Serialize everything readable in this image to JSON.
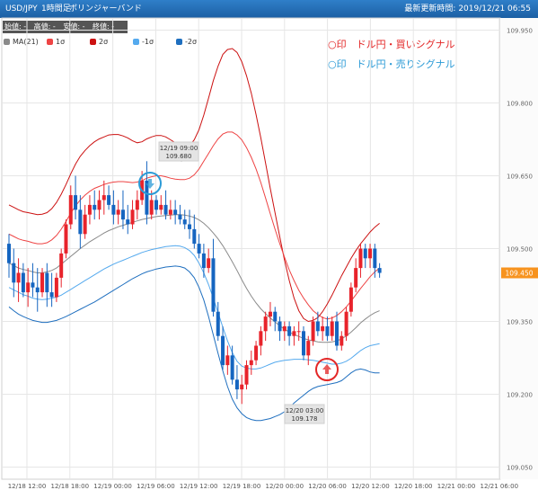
{
  "header": {
    "symbol": "USD/JPY",
    "timeframe": "1時間足",
    "indicator": "ボリンジャーバンド",
    "updated": "最新更新時間: 2019/12/21 06:55"
  },
  "ohlc_bar": {
    "open": "始値: -",
    "high": "高値: -",
    "low": "安値: -",
    "close": "終値: -"
  },
  "legend": [
    {
      "label": "MA(21)",
      "color": "#8a8a8a"
    },
    {
      "label": "1σ",
      "color": "#ee4444"
    },
    {
      "label": "2σ",
      "color": "#cc1111"
    },
    {
      "label": "-1σ",
      "color": "#55aaee"
    },
    {
      "label": "-2σ",
      "color": "#1f6fbf"
    }
  ],
  "notes": [
    {
      "text": "○印　ドル円・買いシグナル",
      "color": "#e32626"
    },
    {
      "text": "○印　ドル円・売りシグナル",
      "color": "#2a9ad6"
    }
  ],
  "colors": {
    "up": "#e8232b",
    "down": "#1565c0",
    "current_price_bg": "#f7931e",
    "grid": "#e6e6e6"
  },
  "chart_data": {
    "type": "candlestick",
    "ylim": [
      109.025,
      109.975
    ],
    "yticks": [
      "109.050",
      "109.200",
      "109.350",
      "109.500",
      "109.650",
      "109.800",
      "109.950"
    ],
    "xticks": [
      "12/18 12:00",
      "12/18 18:00",
      "12/19 00:00",
      "12/19 06:00",
      "12/19 12:00",
      "12/19 18:00",
      "12/20 00:00",
      "12/20 06:00",
      "12/20 12:00",
      "12/20 18:00",
      "12/21 00:00",
      "12/21 06:00"
    ],
    "current_price": "109.450",
    "annotations": [
      {
        "label": "12/19 09:00",
        "value": "109.680"
      },
      {
        "label": "12/20 03:00",
        "value": "109.178"
      }
    ],
    "candles": [
      [
        109.51,
        109.53,
        109.44,
        109.47
      ],
      [
        109.47,
        109.5,
        109.4,
        109.43
      ],
      [
        109.43,
        109.48,
        109.39,
        109.45
      ],
      [
        109.45,
        109.47,
        109.4,
        109.41
      ],
      [
        109.41,
        109.46,
        109.38,
        109.43
      ],
      [
        109.43,
        109.47,
        109.4,
        109.42
      ],
      [
        109.42,
        109.46,
        109.37,
        109.41
      ],
      [
        109.41,
        109.46,
        109.4,
        109.45
      ],
      [
        109.45,
        109.47,
        109.38,
        109.41
      ],
      [
        109.41,
        109.45,
        109.38,
        109.4
      ],
      [
        109.4,
        109.45,
        109.39,
        109.44
      ],
      [
        109.44,
        109.5,
        109.42,
        109.49
      ],
      [
        109.49,
        109.56,
        109.48,
        109.55
      ],
      [
        109.55,
        109.63,
        109.54,
        109.61
      ],
      [
        109.61,
        109.65,
        109.56,
        109.58
      ],
      [
        109.58,
        109.61,
        109.5,
        109.53
      ],
      [
        109.53,
        109.59,
        109.52,
        109.57
      ],
      [
        109.57,
        109.61,
        109.55,
        109.59
      ],
      [
        109.59,
        109.62,
        109.56,
        109.58
      ],
      [
        109.58,
        109.62,
        109.56,
        109.6
      ],
      [
        109.6,
        109.64,
        109.57,
        109.61
      ],
      [
        109.61,
        109.63,
        109.58,
        109.59
      ],
      [
        109.59,
        109.62,
        109.55,
        109.57
      ],
      [
        109.57,
        109.6,
        109.55,
        109.58
      ],
      [
        109.58,
        109.62,
        109.54,
        109.56
      ],
      [
        109.56,
        109.59,
        109.53,
        109.55
      ],
      [
        109.55,
        109.6,
        109.54,
        109.58
      ],
      [
        109.58,
        109.62,
        109.56,
        109.6
      ],
      [
        109.6,
        109.66,
        109.59,
        109.64
      ],
      [
        109.64,
        109.68,
        109.55,
        109.57
      ],
      [
        109.57,
        109.62,
        109.56,
        109.6
      ],
      [
        109.6,
        109.61,
        109.57,
        109.58
      ],
      [
        109.58,
        109.61,
        109.57,
        109.59
      ],
      [
        109.59,
        109.62,
        109.56,
        109.57
      ],
      [
        109.57,
        109.6,
        109.56,
        109.58
      ],
      [
        109.58,
        109.6,
        109.55,
        109.57
      ],
      [
        109.57,
        109.59,
        109.55,
        109.56
      ],
      [
        109.56,
        109.58,
        109.54,
        109.55
      ],
      [
        109.55,
        109.58,
        109.52,
        109.54
      ],
      [
        109.54,
        109.57,
        109.5,
        109.51
      ],
      [
        109.51,
        109.53,
        109.48,
        109.49
      ],
      [
        109.49,
        109.51,
        109.44,
        109.46
      ],
      [
        109.46,
        109.5,
        109.45,
        109.48
      ],
      [
        109.48,
        109.52,
        109.36,
        109.37
      ],
      [
        109.37,
        109.39,
        109.31,
        109.32
      ],
      [
        109.32,
        109.34,
        109.25,
        109.26
      ],
      [
        109.26,
        109.3,
        109.24,
        109.28
      ],
      [
        109.28,
        109.3,
        109.22,
        109.23
      ],
      [
        109.23,
        109.26,
        109.19,
        109.21
      ],
      [
        109.21,
        109.24,
        109.18,
        109.22
      ],
      [
        109.22,
        109.27,
        109.21,
        109.26
      ],
      [
        109.26,
        109.29,
        109.24,
        109.27
      ],
      [
        109.27,
        109.31,
        109.26,
        109.3
      ],
      [
        109.3,
        109.34,
        109.28,
        109.33
      ],
      [
        109.33,
        109.37,
        109.31,
        109.36
      ],
      [
        109.36,
        109.39,
        109.34,
        109.37
      ],
      [
        109.37,
        109.38,
        109.33,
        109.35
      ],
      [
        109.35,
        109.36,
        109.31,
        109.33
      ],
      [
        109.33,
        109.35,
        109.31,
        109.34
      ],
      [
        109.34,
        109.35,
        109.3,
        109.32
      ],
      [
        109.32,
        109.34,
        109.3,
        109.33
      ],
      [
        109.33,
        109.35,
        109.31,
        109.33
      ],
      [
        109.33,
        109.34,
        109.27,
        109.28
      ],
      [
        109.28,
        109.32,
        109.26,
        109.31
      ],
      [
        109.31,
        109.36,
        109.3,
        109.35
      ],
      [
        109.35,
        109.37,
        109.32,
        109.33
      ],
      [
        109.33,
        109.36,
        109.31,
        109.34
      ],
      [
        109.34,
        109.36,
        109.31,
        109.32
      ],
      [
        109.32,
        109.36,
        109.31,
        109.35
      ],
      [
        109.35,
        109.37,
        109.29,
        109.3
      ],
      [
        109.3,
        109.33,
        109.29,
        109.32
      ],
      [
        109.32,
        109.38,
        109.31,
        109.37
      ],
      [
        109.37,
        109.43,
        109.36,
        109.42
      ],
      [
        109.42,
        109.48,
        109.41,
        109.46
      ],
      [
        109.46,
        109.51,
        109.44,
        109.5
      ],
      [
        109.5,
        109.51,
        109.46,
        109.48
      ],
      [
        109.48,
        109.51,
        109.46,
        109.5
      ],
      [
        109.5,
        109.51,
        109.44,
        109.46
      ],
      [
        109.46,
        109.47,
        109.44,
        109.45
      ]
    ],
    "ma21": [
      109.47,
      109.465,
      109.46,
      109.457,
      109.455,
      109.452,
      109.45,
      109.45,
      109.452,
      109.455,
      109.46,
      109.468,
      109.476,
      109.484,
      109.492,
      109.5,
      109.507,
      109.514,
      109.52,
      109.526,
      109.532,
      109.537,
      109.541,
      109.545,
      109.548,
      109.551,
      109.554,
      109.557,
      109.56,
      109.562,
      109.564,
      109.566,
      109.567,
      109.568,
      109.569,
      109.57,
      109.57,
      109.569,
      109.567,
      109.564,
      109.559,
      109.552,
      109.543,
      109.532,
      109.52,
      109.506,
      109.49,
      109.473,
      109.455,
      109.436,
      109.418,
      109.402,
      109.388,
      109.376,
      109.366,
      109.357,
      109.349,
      109.341,
      109.334,
      109.328,
      109.323,
      109.319,
      109.315,
      109.312,
      109.31,
      109.308,
      109.307,
      109.307,
      109.308,
      109.31,
      109.314,
      109.32,
      109.328,
      109.337,
      109.347,
      109.355,
      109.362,
      109.368,
      109.372
    ],
    "up1": [
      109.53,
      109.525,
      109.52,
      109.517,
      109.515,
      109.512,
      109.51,
      109.51,
      109.512,
      109.518,
      109.527,
      109.54,
      109.556,
      109.573,
      109.588,
      109.6,
      109.61,
      109.618,
      109.624,
      109.628,
      109.632,
      109.635,
      109.637,
      109.638,
      109.638,
      109.637,
      109.636,
      109.637,
      109.64,
      109.645,
      109.648,
      109.65,
      109.65,
      109.648,
      109.645,
      109.643,
      109.642,
      109.642,
      109.645,
      109.652,
      109.664,
      109.68,
      109.696,
      109.712,
      109.726,
      109.736,
      109.74,
      109.74,
      109.734,
      109.724,
      109.708,
      109.688,
      109.664,
      109.636,
      109.604,
      109.572,
      109.54,
      109.51,
      109.482,
      109.456,
      109.434,
      109.414,
      109.398,
      109.384,
      109.372,
      109.364,
      109.358,
      109.355,
      109.357,
      109.362,
      109.37,
      109.38,
      109.392,
      109.405,
      109.418,
      109.43,
      109.442,
      109.452,
      109.46
    ],
    "up2": [
      109.59,
      109.585,
      109.58,
      109.576,
      109.574,
      109.572,
      109.57,
      109.571,
      109.574,
      109.582,
      109.595,
      109.612,
      109.632,
      109.654,
      109.674,
      109.69,
      109.702,
      109.712,
      109.72,
      109.726,
      109.73,
      109.734,
      109.735,
      109.735,
      109.732,
      109.728,
      109.722,
      109.718,
      109.72,
      109.726,
      109.73,
      109.733,
      109.733,
      109.73,
      109.724,
      109.718,
      109.712,
      109.71,
      109.712,
      109.724,
      109.745,
      109.775,
      109.81,
      109.846,
      109.876,
      109.9,
      109.91,
      109.912,
      109.904,
      109.885,
      109.856,
      109.82,
      109.776,
      109.728,
      109.676,
      109.624,
      109.574,
      109.524,
      109.476,
      109.434,
      109.398,
      109.372,
      109.356,
      109.35,
      109.352,
      109.358,
      109.37,
      109.386,
      109.404,
      109.424,
      109.444,
      109.462,
      109.48,
      109.496,
      109.51,
      109.522,
      109.534,
      109.544,
      109.552
    ],
    "lo1": [
      109.42,
      109.415,
      109.41,
      109.405,
      109.402,
      109.398,
      109.396,
      109.395,
      109.396,
      109.398,
      109.4,
      109.404,
      109.41,
      109.416,
      109.422,
      109.428,
      109.434,
      109.44,
      109.446,
      109.452,
      109.458,
      109.463,
      109.468,
      109.472,
      109.476,
      109.48,
      109.484,
      109.488,
      109.492,
      109.495,
      109.498,
      109.5,
      109.502,
      109.504,
      109.505,
      109.506,
      109.505,
      109.502,
      109.496,
      109.486,
      109.47,
      109.45,
      109.426,
      109.398,
      109.368,
      109.338,
      109.31,
      109.286,
      109.268,
      109.258,
      109.254,
      109.252,
      109.252,
      109.254,
      109.258,
      109.262,
      109.266,
      109.268,
      109.27,
      109.271,
      109.272,
      109.272,
      109.272,
      109.271,
      109.27,
      109.268,
      109.266,
      109.264,
      109.262,
      109.262,
      109.264,
      109.268,
      109.274,
      109.282,
      109.29,
      109.296,
      109.3,
      109.302,
      109.304
    ],
    "lo2": [
      109.38,
      109.372,
      109.365,
      109.36,
      109.356,
      109.352,
      109.35,
      109.348,
      109.348,
      109.35,
      109.352,
      109.356,
      109.36,
      109.365,
      109.37,
      109.375,
      109.38,
      109.385,
      109.39,
      109.396,
      109.402,
      109.408,
      109.414,
      109.42,
      109.426,
      109.432,
      109.438,
      109.443,
      109.448,
      109.452,
      109.455,
      109.458,
      109.46,
      109.462,
      109.463,
      109.464,
      109.463,
      109.46,
      109.452,
      109.44,
      109.42,
      109.394,
      109.36,
      109.322,
      109.284,
      109.248,
      109.216,
      109.19,
      109.172,
      109.16,
      109.152,
      109.148,
      109.146,
      109.146,
      109.148,
      109.15,
      109.154,
      109.158,
      109.164,
      109.172,
      109.182,
      109.19,
      109.198,
      109.206,
      109.212,
      109.216,
      109.218,
      109.22,
      109.222,
      109.224,
      109.228,
      109.236,
      109.244,
      109.25,
      109.252,
      109.25,
      109.246,
      109.244,
      109.244
    ]
  }
}
